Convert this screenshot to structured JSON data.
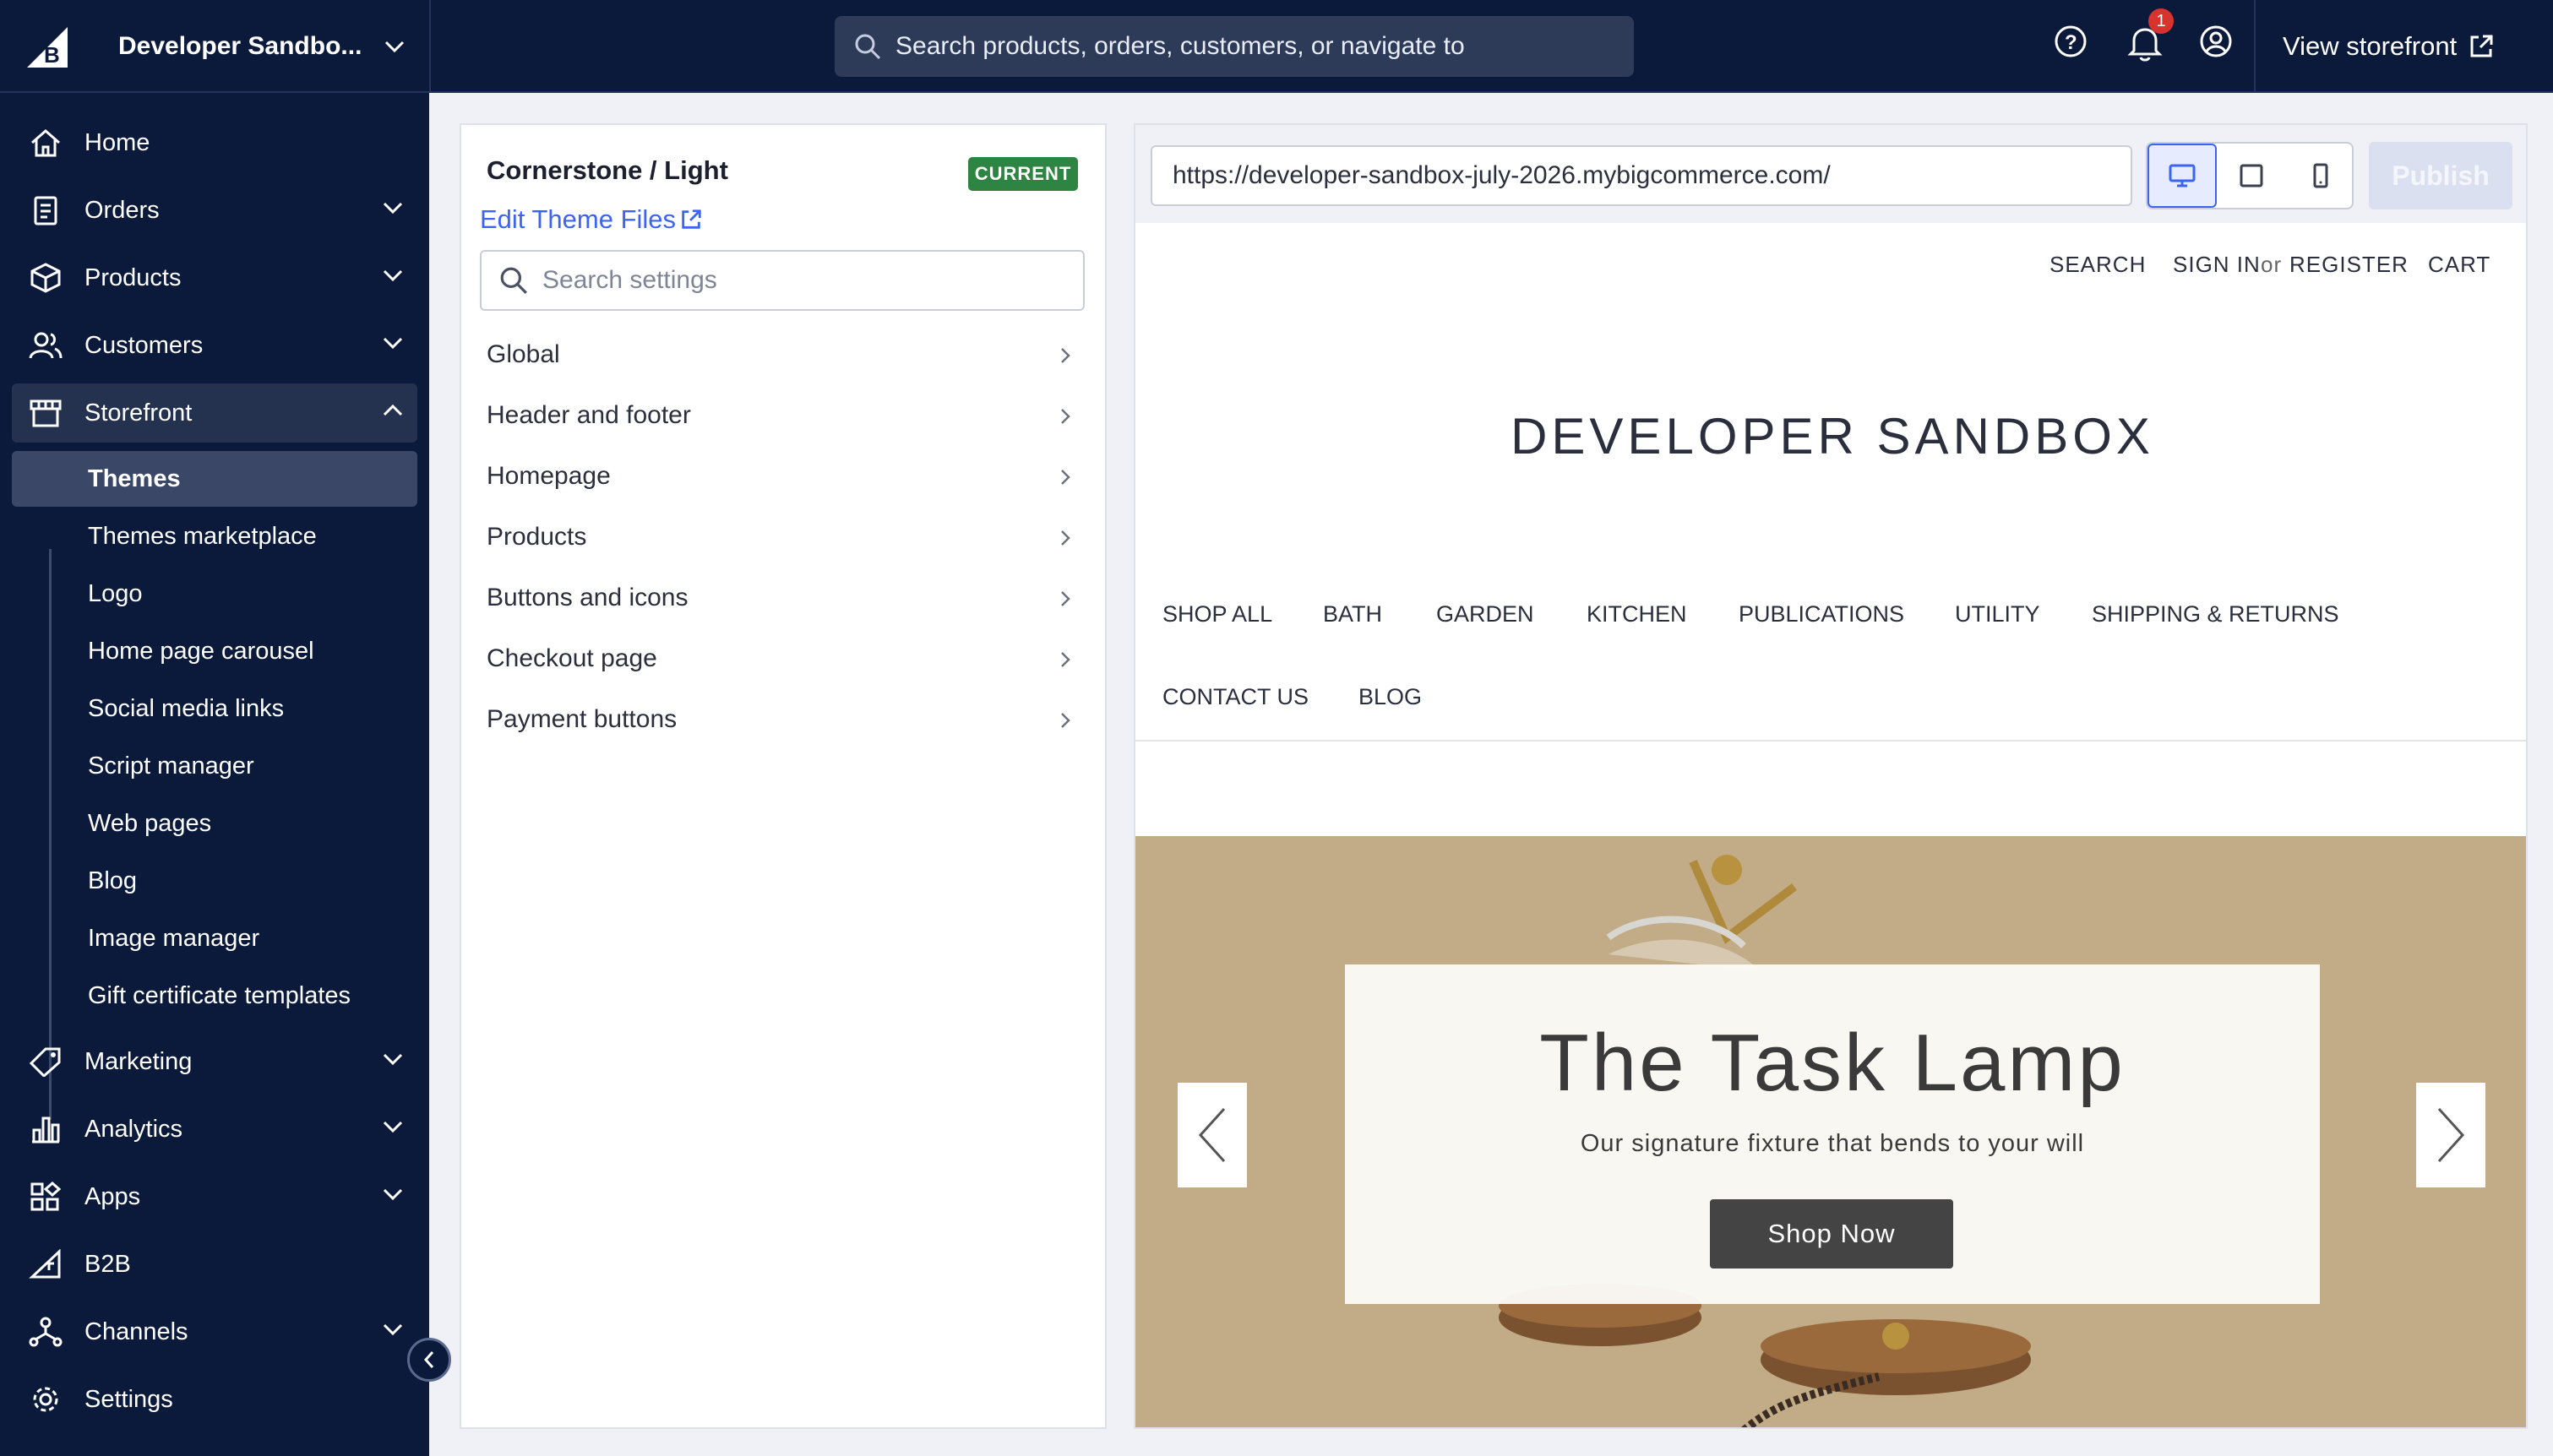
{
  "topbar": {
    "store_name": "Developer Sandbo...",
    "search_placeholder": "Search products, orders, customers, or navigate to",
    "notification_count": "1",
    "view_storefront": "View storefront"
  },
  "sidebar": {
    "items": [
      {
        "label": "Home",
        "icon": "home-icon"
      },
      {
        "label": "Orders",
        "icon": "orders-icon"
      },
      {
        "label": "Products",
        "icon": "box-icon"
      },
      {
        "label": "Customers",
        "icon": "customers-icon"
      },
      {
        "label": "Storefront",
        "icon": "storefront-icon"
      },
      {
        "label": "Marketing",
        "icon": "tag-icon"
      },
      {
        "label": "Analytics",
        "icon": "analytics-icon"
      },
      {
        "label": "Apps",
        "icon": "apps-icon"
      },
      {
        "label": "B2B",
        "icon": "b2b-icon"
      },
      {
        "label": "Channels",
        "icon": "channels-icon"
      },
      {
        "label": "Settings",
        "icon": "gear-icon"
      }
    ],
    "storefront_sub": [
      "Themes",
      "Themes marketplace",
      "Logo",
      "Home page carousel",
      "Social media links",
      "Script manager",
      "Web pages",
      "Blog",
      "Image manager",
      "Gift certificate templates"
    ]
  },
  "panel": {
    "theme_name": "Cornerstone / Light",
    "badge": "CURRENT",
    "edit_files": "Edit Theme Files",
    "search_placeholder": "Search settings",
    "rows": [
      "Global",
      "Header and footer",
      "Homepage",
      "Products",
      "Buttons and icons",
      "Checkout page",
      "Payment buttons"
    ]
  },
  "preview": {
    "url": "https://developer-sandbox-july-2026.mybigcommerce.com/",
    "publish": "Publish",
    "store": {
      "search": "SEARCH",
      "sign_in": "SIGN IN",
      "or": "or",
      "register": "REGISTER",
      "cart": "CART",
      "title": "DEVELOPER SANDBOX",
      "nav_row1": [
        "SHOP ALL",
        "BATH",
        "GARDEN",
        "KITCHEN",
        "PUBLICATIONS",
        "UTILITY",
        "SHIPPING & RETURNS"
      ],
      "nav_row2": [
        "CONTACT US",
        "BLOG"
      ],
      "hero": {
        "title": "The Task Lamp",
        "subtitle": "Our signature fixture that bends to your will",
        "button": "Shop Now"
      }
    }
  },
  "colors": {
    "nav_bg": "#0b1a3b",
    "accent": "#3c64f4",
    "badge_green": "#2e8442",
    "hero_bg": "#c2ac87"
  }
}
